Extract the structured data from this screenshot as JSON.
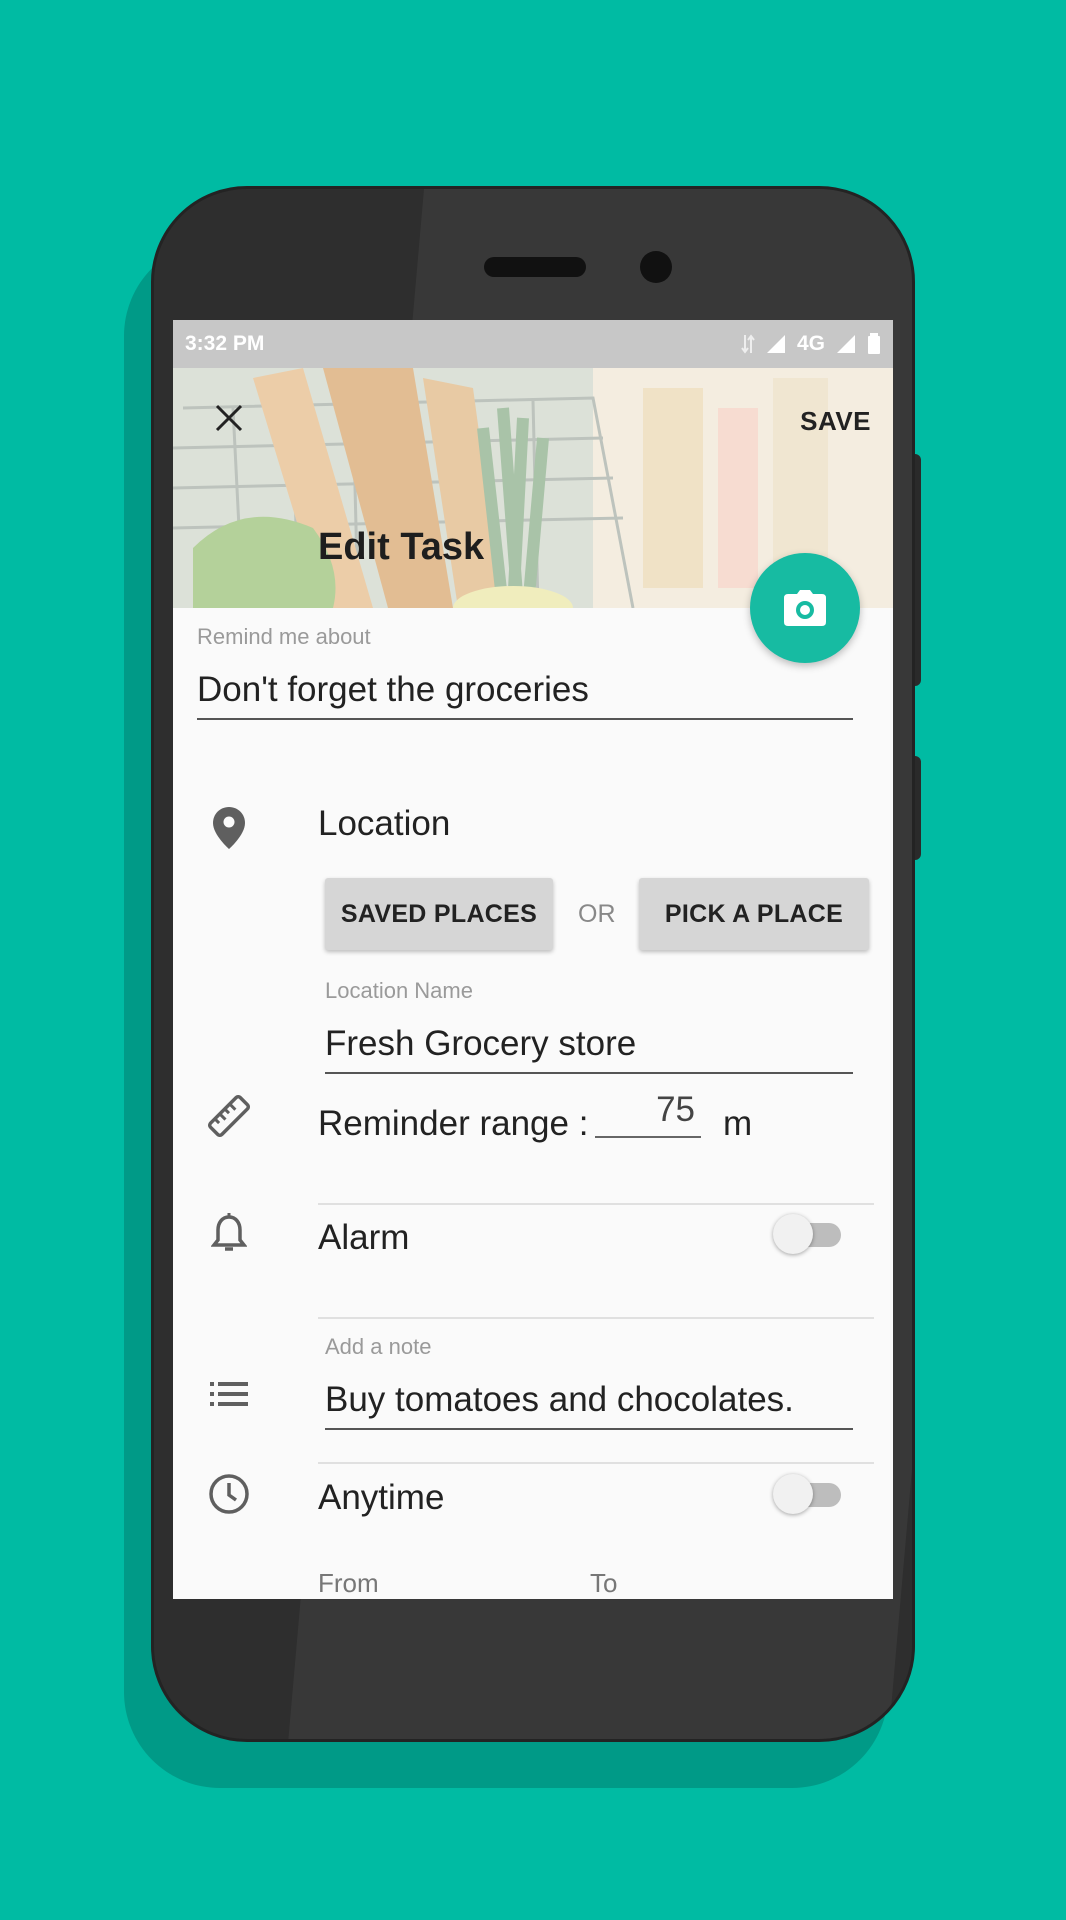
{
  "status_bar": {
    "time": "3:32 PM",
    "network": "4G"
  },
  "header": {
    "title": "Edit Task",
    "save_label": "SAVE"
  },
  "task": {
    "label": "Remind me about",
    "value": "Don't forget the groceries"
  },
  "location": {
    "title": "Location",
    "saved_places_label": "SAVED PLACES",
    "or_label": "OR",
    "pick_place_label": "PICK A PLACE",
    "name_label": "Location Name",
    "name_value": "Fresh Grocery store"
  },
  "range": {
    "label": "Reminder range :",
    "value": "75",
    "unit": "m"
  },
  "alarm": {
    "label": "Alarm",
    "enabled": false
  },
  "note": {
    "label": "Add a note",
    "value": "Buy tomatoes and chocolates."
  },
  "time_window": {
    "label": "Anytime",
    "enabled": false,
    "from_label": "From",
    "to_label": "To"
  },
  "colors": {
    "accent": "#17BBA2",
    "background": "#00BBA3"
  },
  "icons": [
    "close-icon",
    "camera-icon",
    "location-pin-icon",
    "ruler-icon",
    "bell-icon",
    "list-icon",
    "clock-icon"
  ]
}
